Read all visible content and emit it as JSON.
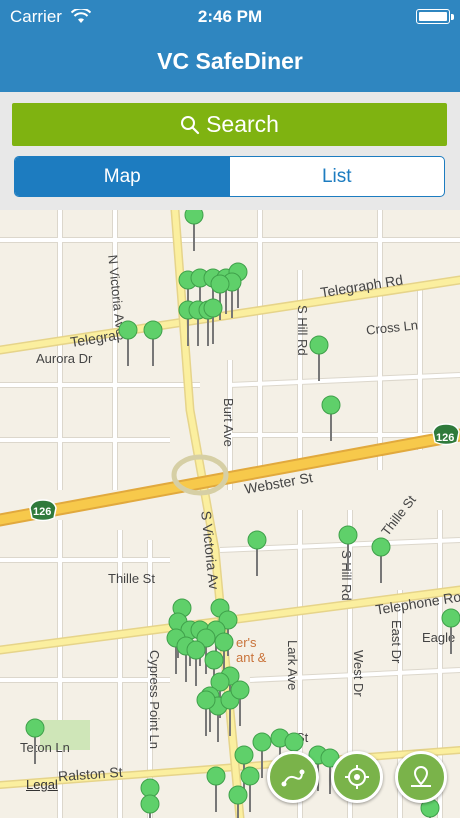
{
  "status_bar": {
    "carrier": "Carrier",
    "time": "2:46 PM"
  },
  "nav": {
    "title": "VC SafeDiner"
  },
  "search": {
    "label": "Search"
  },
  "segments": {
    "map": "Map",
    "list": "List",
    "selected": "Map"
  },
  "map": {
    "legal": "Legal",
    "streets": {
      "telegraph_rd_east": "Telegraph Rd",
      "telegraph_rd_west": "Telegrap",
      "n_victoria_ave": "N Victoria Ave",
      "aurora_dr": "Aurora Dr",
      "cross_ln": "Cross Ln",
      "s_hill_rd_north": "S Hill Rd",
      "burt_ave": "Burt Ave",
      "webster_st": "Webster St",
      "thille_st_east": "Thille St",
      "thille_st_west": "Thille St",
      "s_victoria_ave": "S Victoria Av",
      "telephone_rd": "Telephone Ro",
      "s_hill_rd_south": "S Hill Rd",
      "east_dr": "East Dr",
      "eagle": "Eagle",
      "cypress_point_ln": "Cypress Point Ln",
      "lark_ave": "Lark Ave",
      "west_dr": "West Dr",
      "teton_ln": "Teton Ln",
      "ralston_st": "Ralston St",
      "st": "St",
      "poi": "er's\nant &"
    },
    "highway_shield": "126"
  },
  "map_buttons": [
    "route-icon",
    "locate-icon",
    "map-pin-icon"
  ]
}
